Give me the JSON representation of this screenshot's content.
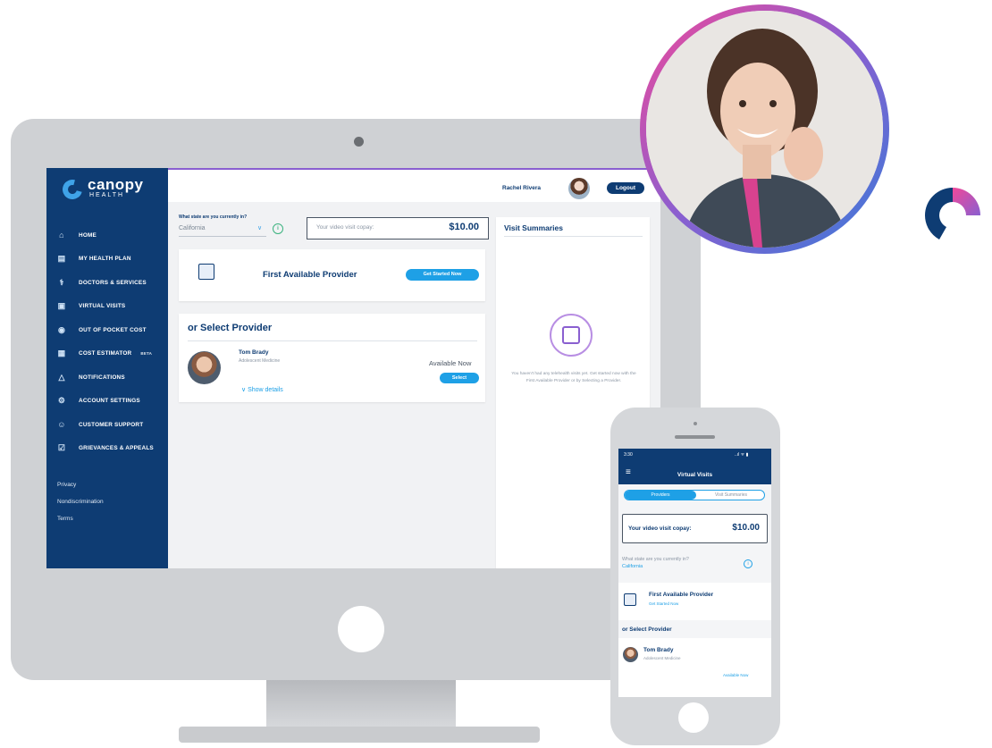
{
  "desktop": {
    "brand": {
      "name": "canopy",
      "sub": "HEALTH"
    },
    "nav": [
      {
        "label": "HOME",
        "icon": "home-icon",
        "glyph": "⌂"
      },
      {
        "label": "MY HEALTH PLAN",
        "icon": "card-icon",
        "glyph": "▤"
      },
      {
        "label": "DOCTORS & SERVICES",
        "icon": "stethoscope-icon",
        "glyph": "⚕"
      },
      {
        "label": "VIRTUAL VISITS",
        "icon": "video-icon",
        "glyph": "▣"
      },
      {
        "label": "OUT OF POCKET COST",
        "icon": "coin-icon",
        "glyph": "◉"
      },
      {
        "label": "COST ESTIMATOR",
        "icon": "calculator-icon",
        "glyph": "▦",
        "badge": "BETA"
      },
      {
        "label": "NOTIFICATIONS",
        "icon": "bell-icon",
        "glyph": "△"
      },
      {
        "label": "ACCOUNT SETTINGS",
        "icon": "gear-icon",
        "glyph": "⚙"
      },
      {
        "label": "CUSTOMER SUPPORT",
        "icon": "support-icon",
        "glyph": "☺"
      },
      {
        "label": "GRIEVANCES & APPEALS",
        "icon": "document-icon",
        "glyph": "☑"
      }
    ],
    "footer_links": [
      "Privacy",
      "Nondiscrimination",
      "Terms"
    ],
    "header": {
      "user_name": "Rachel Rivera",
      "logout_label": "Logout"
    },
    "state": {
      "label": "What state are you currently in?",
      "value": "California"
    },
    "copay": {
      "label": "Your video visit copay:",
      "value": "$10.00"
    },
    "first_provider": {
      "title": "First Available Provider",
      "button": "Get Started Now"
    },
    "select_provider": {
      "title": "or Select Provider",
      "provider": {
        "name": "Tom Brady",
        "specialty": "Adolescent Medicine",
        "status": "Available Now",
        "button": "Select",
        "details": "Show details"
      }
    },
    "visit_summaries": {
      "title": "Visit Summaries",
      "empty": "You haven't had any telehealth visits yet. Get started now with the First Available Provider or by Selecting a Provider."
    }
  },
  "phone": {
    "time": "3:30",
    "signal": "..ıl ᯤ ▮",
    "title": "Virtual Visits",
    "tabs": [
      "Providers",
      "Visit Summaries"
    ],
    "copay": {
      "label": "Your video visit copay:",
      "value": "$10.00"
    },
    "state": {
      "label": "What state are you currently in?",
      "value": "California"
    },
    "first_provider": {
      "title": "First Available Provider",
      "link": "Get Started Now"
    },
    "select_title": "or Select Provider",
    "provider": {
      "name": "Tom Brady",
      "specialty": "Adolescent Medicine",
      "status": "Available Now"
    }
  },
  "colors": {
    "navy": "#0e3c73",
    "accent_blue": "#1ea0e6",
    "purple": "#8a5fd0",
    "pink": "#f0499a"
  }
}
